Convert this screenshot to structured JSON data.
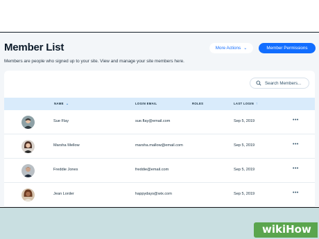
{
  "header": {
    "title": "Member List",
    "subtitle": "Members are people who signed up to your site. View and manage your site members here.",
    "more_actions_label": "More Actions",
    "permissions_label": "Member Permissions"
  },
  "search": {
    "placeholder": "Search Members..."
  },
  "table": {
    "columns": {
      "name": "NAME",
      "email": "LOGIN EMAIL",
      "roles": "ROLES",
      "last_login": "LAST LOGIN"
    },
    "rows": [
      {
        "name": "Sue Flay",
        "email": "sue.flay@email.com",
        "roles": "",
        "last_login": "Sep 5, 2019",
        "actions": "•••"
      },
      {
        "name": "Marsha Mellow",
        "email": "marsha.mallow@email.com",
        "roles": "",
        "last_login": "Sep 5, 2019",
        "actions": "•••"
      },
      {
        "name": "Freddie Jones",
        "email": "freddie@email.com",
        "roles": "",
        "last_login": "Sep 5, 2019",
        "actions": "•••"
      },
      {
        "name": "Jean Lorder",
        "email": "happydays@wix.com",
        "roles": "",
        "last_login": "Sep 5, 2019",
        "actions": "•••"
      }
    ]
  },
  "watermark": {
    "wiki": "wiki",
    "how": "How"
  },
  "colors": {
    "accent": "#116dff",
    "header_row": "#d9ebfb",
    "background": "#c9dfe1",
    "logo_green": "#5aa54e"
  }
}
